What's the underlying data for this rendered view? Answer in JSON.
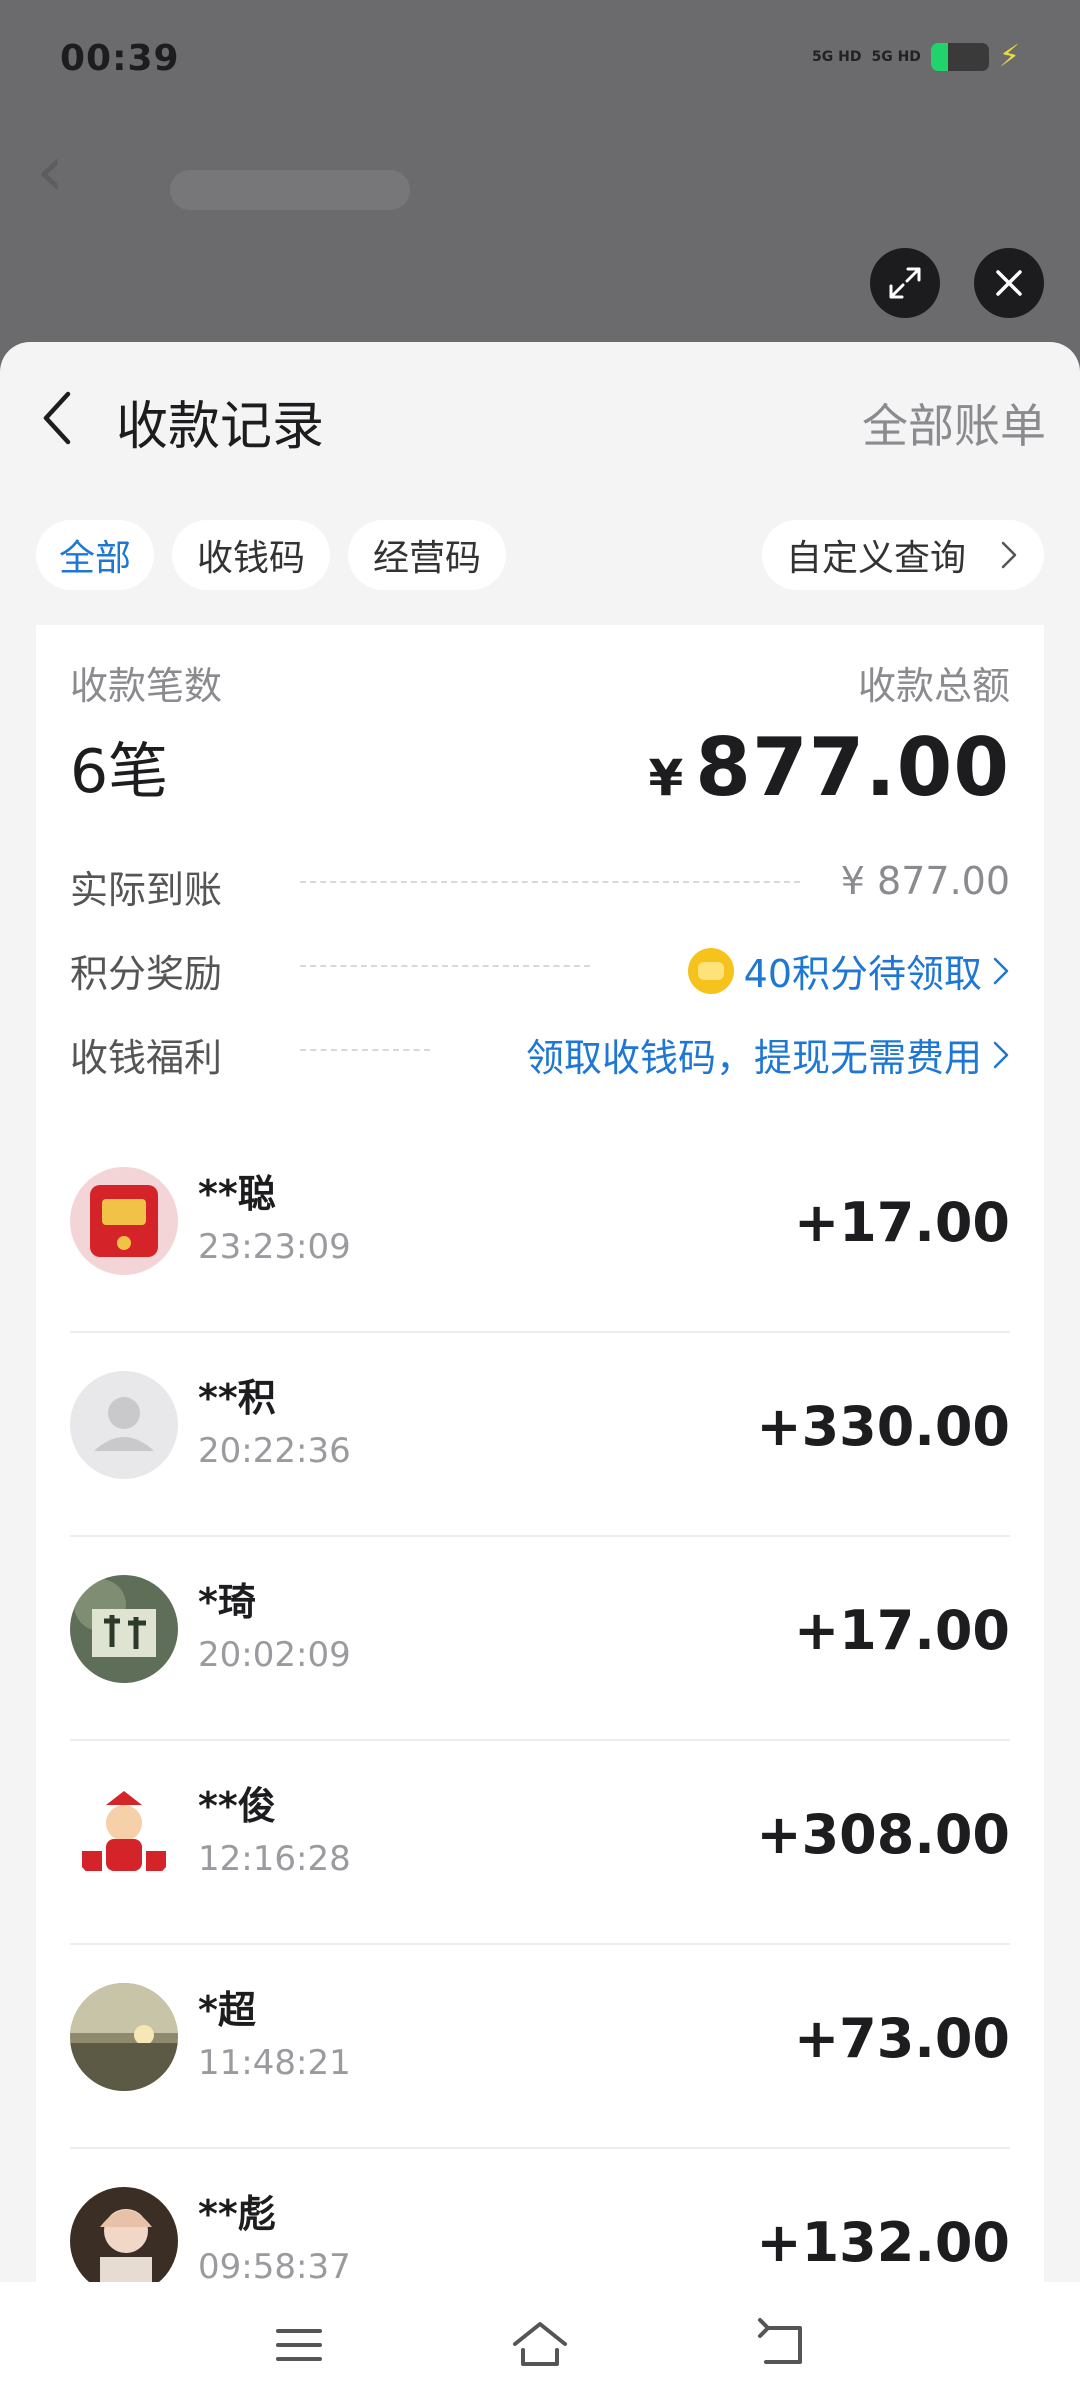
{
  "status_bar": {
    "time": "00:39",
    "signal1": "5G HD",
    "signal2": "5G HD",
    "battery_level": 0.3,
    "battery_color": "#22d36b"
  },
  "overlay_buttons": {
    "expand_icon": "expand-icon",
    "close_icon": "close-icon"
  },
  "header": {
    "title": "收款记录",
    "all_bills": "全部账单"
  },
  "tabs": [
    {
      "label": "全部",
      "active": true
    },
    {
      "label": "收钱码",
      "active": false
    },
    {
      "label": "经营码",
      "active": false
    }
  ],
  "custom_query": "自定义查询",
  "summary": {
    "count_label": "收款笔数",
    "count_value": "6笔",
    "total_label": "收款总额",
    "currency": "¥",
    "total_value": "877.00"
  },
  "details": [
    {
      "key": "实际到账",
      "value": "¥ 877.00"
    },
    {
      "key": "积分奖励",
      "value": "40积分待领取"
    },
    {
      "key": "收钱福利",
      "value": "领取收钱码，提现无需费用"
    }
  ],
  "transactions": [
    {
      "name": "**聪",
      "time": "23:23:09",
      "amount": "+17.00"
    },
    {
      "name": "**积",
      "time": "20:22:36",
      "amount": "+330.00"
    },
    {
      "name": "*琦",
      "time": "20:02:09",
      "amount": "+17.00"
    },
    {
      "name": "**俊",
      "time": "12:16:28",
      "amount": "+308.00"
    },
    {
      "name": "*超",
      "time": "11:48:21",
      "amount": "+73.00"
    },
    {
      "name": "**彪",
      "time": "09:58:37",
      "amount": "+132.00"
    }
  ],
  "colors": {
    "accent": "#1e77d4",
    "text": "#1d1d1f",
    "muted": "#8a8a8f"
  }
}
